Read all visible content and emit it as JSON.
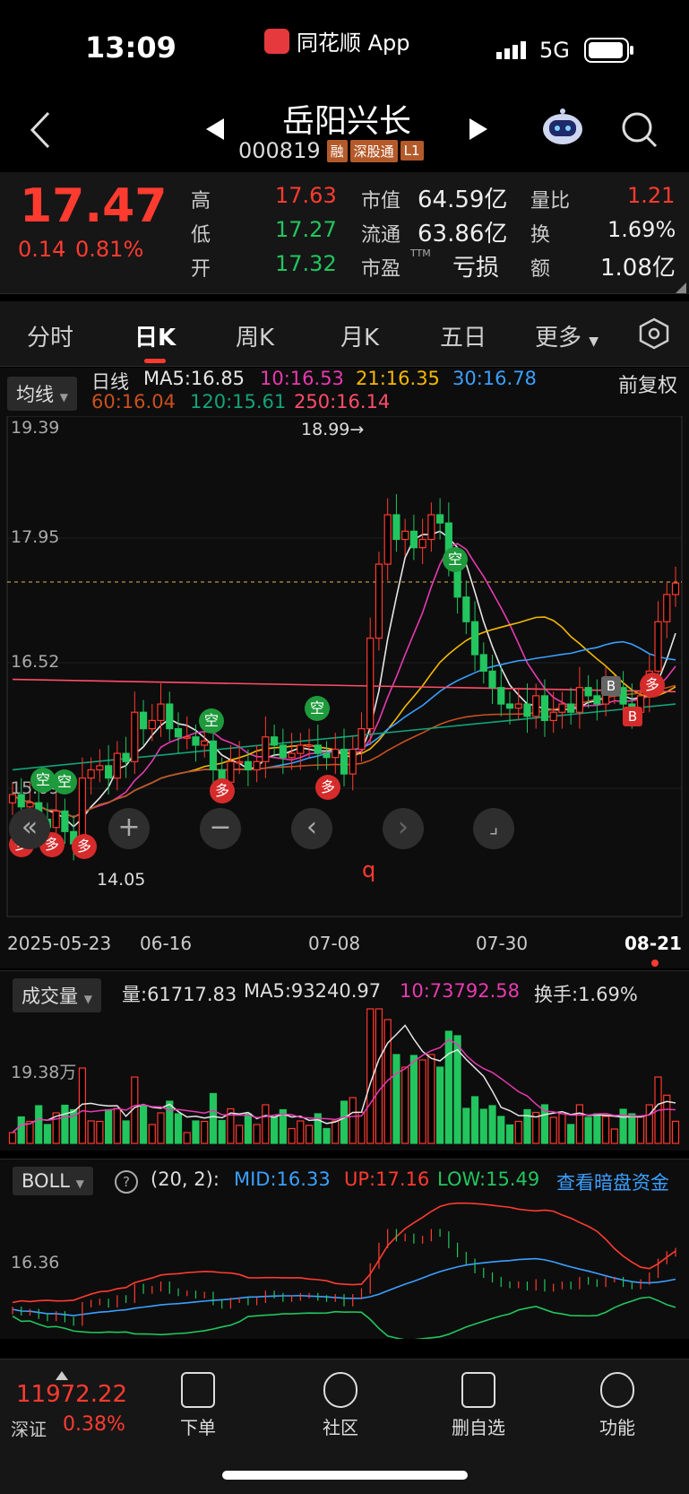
{
  "status_bar": {
    "time": "13:09",
    "app_name": "同花顺 App",
    "network": "5G"
  },
  "header": {
    "stock_name": "岳阳兴长",
    "stock_code": "000819",
    "badges": [
      "融",
      "深股通",
      "L1"
    ]
  },
  "quote": {
    "price": "17.47",
    "change": "0.14",
    "change_pct": "0.81%",
    "high_label": "高",
    "high": "17.63",
    "low_label": "低",
    "low": "17.27",
    "open_label": "开",
    "open": "17.32",
    "mktcap_label": "市值",
    "mktcap": "64.59亿",
    "float_label": "流通",
    "float": "63.86亿",
    "pe_label": "市盈",
    "pe_sup": "TTM",
    "pe": "亏损",
    "volratio_label": "量比",
    "volratio": "1.21",
    "turnover_label": "换",
    "turnover": "1.69%",
    "amount_label": "额",
    "amount": "1.08亿"
  },
  "tabs": [
    "分时",
    "日K",
    "周K",
    "月K",
    "五日",
    "更多"
  ],
  "kline": {
    "ma_button": "均线",
    "period": "日线",
    "ma_values": [
      {
        "label": "MA5:16.85",
        "color": "#e6e6e6"
      },
      {
        "label": "10:16.53",
        "color": "#e63ab0"
      },
      {
        "label": "21:16.35",
        "color": "#f5b800"
      },
      {
        "label": "30:16.78",
        "color": "#3aa0ff"
      },
      {
        "label": "60:16.04",
        "color": "#c9501e"
      },
      {
        "label": "120:15.61",
        "color": "#12a37a"
      },
      {
        "label": "250:16.14",
        "color": "#ff4d6a"
      }
    ],
    "adjust": "前复权",
    "y_ticks": [
      "19.39",
      "17.95",
      "16.52",
      "15.09"
    ],
    "high_marker": "18.99→",
    "low_marker": "14.05",
    "dates": [
      "2025-05-23",
      "06-16",
      "07-08",
      "07-30",
      "08-21"
    ],
    "signals": {
      "kong": "空",
      "duo": "多",
      "buy": "B"
    },
    "ctrl_icons": [
      "rewind-icon",
      "zoom-in-icon",
      "zoom-out-icon",
      "prev-icon",
      "next-icon",
      "fullscreen-icon"
    ],
    "q_label": "q"
  },
  "volume": {
    "button": "成交量",
    "vol_label": "量:61717.83",
    "ma5_label": "MA5:93240.97",
    "ma10_label": "10:73792.58",
    "turnover_label": "换手:1.69%",
    "y_tick": "19.38万"
  },
  "boll": {
    "button": "BOLL",
    "params": "(20, 2):",
    "mid": "MID:16.33",
    "up": "UP:17.16",
    "low": "LOW:15.49",
    "link": "查看暗盘资金",
    "y_tick": "16.36"
  },
  "bottom": {
    "index_value": "11972.22",
    "index_name": "深证",
    "index_pct": "0.38%",
    "items": [
      "下单",
      "社区",
      "删自选",
      "功能"
    ]
  },
  "chart_data": {
    "type": "candlestick",
    "ylim": [
      14.05,
      19.39
    ],
    "closes": [
      14.9,
      14.75,
      14.8,
      14.6,
      14.5,
      14.7,
      14.45,
      14.3,
      15.1,
      15.2,
      15.25,
      15.1,
      15.4,
      15.3,
      15.9,
      15.7,
      15.8,
      16.0,
      15.7,
      15.6,
      15.6,
      15.5,
      15.55,
      15.2,
      15.05,
      15.3,
      15.3,
      15.2,
      15.3,
      15.6,
      15.5,
      15.35,
      15.4,
      15.5,
      15.5,
      15.4,
      15.35,
      15.45,
      15.15,
      15.45,
      15.7,
      16.8,
      17.7,
      18.3,
      18.0,
      18.1,
      17.9,
      18.0,
      18.3,
      18.2,
      17.7,
      17.3,
      17.0,
      16.6,
      16.4,
      16.2,
      16.0,
      15.95,
      16.0,
      15.85,
      16.1,
      15.8,
      15.9,
      16.0,
      15.9,
      16.2,
      16.1,
      16.0,
      16.2,
      16.2,
      16.0,
      15.9,
      16.1,
      16.4,
      17.0,
      17.33,
      17.47
    ],
    "volume_ma10_note": "10:73792.58"
  }
}
